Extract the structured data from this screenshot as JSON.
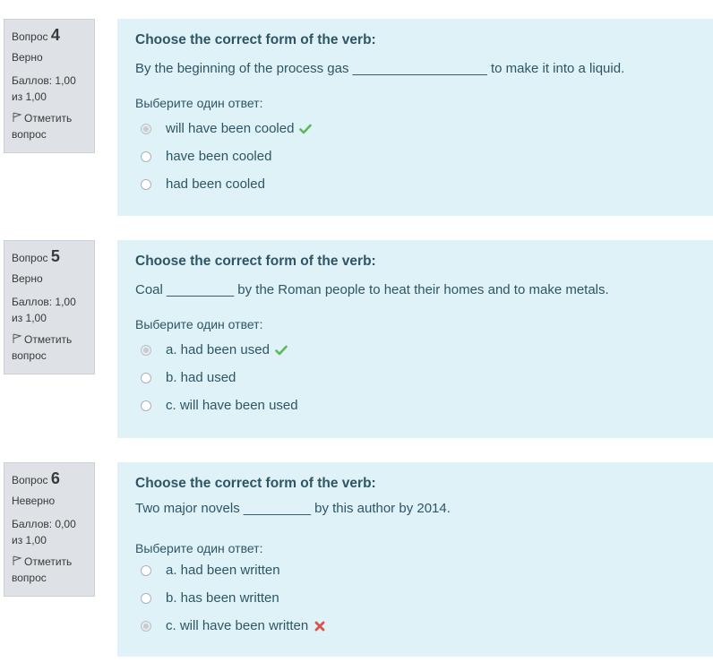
{
  "questions": [
    {
      "label": "Вопрос",
      "number": "4",
      "state": "Верно",
      "grade": "Баллов: 1,00 из 1,00",
      "flag_label": "Отметить вопрос",
      "instruction": "Choose the correct form of the verb:",
      "text": "By the beginning of the process gas __________________ to make it into a liquid.",
      "prompt": "Выберите один ответ:",
      "options": [
        {
          "label": "will have been cooled",
          "checked": true,
          "mark": "check-icon"
        },
        {
          "label": "have been cooled",
          "checked": false,
          "mark": ""
        },
        {
          "label": "had been cooled",
          "checked": false,
          "mark": ""
        }
      ]
    },
    {
      "label": "Вопрос",
      "number": "5",
      "state": "Верно",
      "grade": "Баллов: 1,00 из 1,00",
      "flag_label": "Отметить вопрос",
      "instruction": "Choose the correct form of the verb:",
      "text": "Coal _________ by the Roman people to heat their homes and to make metals.",
      "prompt": "Выберите один ответ:",
      "options": [
        {
          "label": "a. had been used",
          "checked": true,
          "mark": "check-icon"
        },
        {
          "label": "b. had used",
          "checked": false,
          "mark": ""
        },
        {
          "label": "c. will have been used",
          "checked": false,
          "mark": ""
        }
      ]
    },
    {
      "label": "Вопрос",
      "number": "6",
      "state": "Неверно",
      "grade": "Баллов: 0,00 из 1,00",
      "flag_label": "Отметить вопрос",
      "instruction": "Choose the correct form of the verb:",
      "text": "Two major novels _________ by this author by 2014.",
      "prompt": "Выберите один ответ:",
      "options": [
        {
          "label": "a. had been written",
          "checked": false,
          "mark": ""
        },
        {
          "label": "b. has been written",
          "checked": false,
          "mark": ""
        },
        {
          "label": "c. will have been written",
          "checked": true,
          "mark": "cross-icon"
        }
      ]
    }
  ],
  "colors": {
    "info_bg": "#dee2e6",
    "content_bg": "#def2f8",
    "text": "#2f5564",
    "correct": "#5cb85c",
    "incorrect": "#d9534f"
  }
}
